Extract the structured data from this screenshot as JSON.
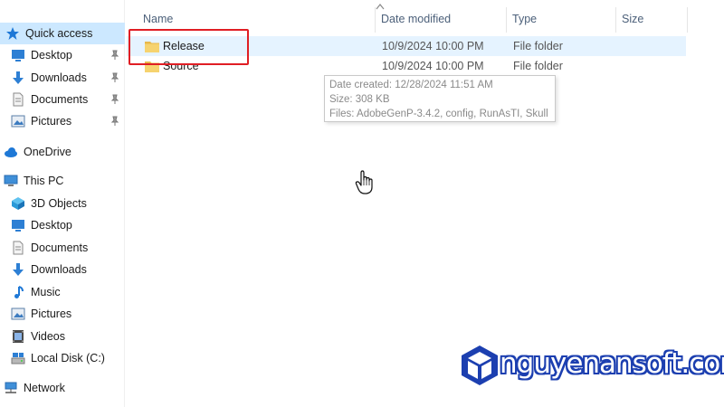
{
  "sidebar": {
    "quick_access": {
      "label": "Quick access",
      "icon": "star-icon"
    },
    "quick_items": [
      {
        "label": "Desktop",
        "icon": "desktop-icon"
      },
      {
        "label": "Downloads",
        "icon": "downloads-icon"
      },
      {
        "label": "Documents",
        "icon": "documents-icon"
      },
      {
        "label": "Pictures",
        "icon": "pictures-icon"
      }
    ],
    "onedrive": {
      "label": "OneDrive",
      "icon": "cloud-icon"
    },
    "this_pc": {
      "label": "This PC",
      "icon": "computer-icon"
    },
    "pc_items": [
      {
        "label": "3D Objects",
        "icon": "3d-objects-icon"
      },
      {
        "label": "Desktop",
        "icon": "desktop-icon"
      },
      {
        "label": "Documents",
        "icon": "documents-icon"
      },
      {
        "label": "Downloads",
        "icon": "downloads-icon"
      },
      {
        "label": "Music",
        "icon": "music-icon"
      },
      {
        "label": "Pictures",
        "icon": "pictures-icon"
      },
      {
        "label": "Videos",
        "icon": "videos-icon"
      },
      {
        "label": "Local Disk (C:)",
        "icon": "drive-icon"
      }
    ],
    "network": {
      "label": "Network",
      "icon": "network-icon"
    }
  },
  "columns": {
    "name": "Name",
    "date_modified": "Date modified",
    "type": "Type",
    "size": "Size"
  },
  "files": [
    {
      "name": "Release",
      "date_modified": "10/9/2024 10:00 PM",
      "type": "File folder",
      "size": ""
    },
    {
      "name": "Source",
      "date_modified": "10/9/2024 10:00 PM",
      "type": "File folder",
      "size": ""
    }
  ],
  "tooltip": {
    "date_created": "Date created: 12/28/2024 11:51 AM",
    "size": "Size: 308 KB",
    "files": "Files: AdobeGenP-3.4.2, config, RunAsTI, Skull"
  },
  "watermark": {
    "text": "nguyenansoft.com"
  },
  "colors": {
    "selection": "#cce8ff",
    "hover": "#e5f3ff",
    "highlight_box": "#e01e24",
    "folder": "#f6d36f",
    "accent_blue": "#1e78d6",
    "watermark_blue": "#1c3fb0"
  }
}
